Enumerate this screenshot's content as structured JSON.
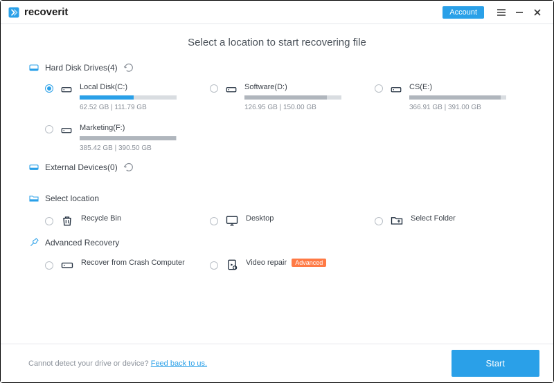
{
  "brand": {
    "name": "recoverit"
  },
  "account_label": "Account",
  "page_title": "Select a location to start recovering file",
  "sections": {
    "hdd": {
      "label": "Hard Disk Drives(4)"
    },
    "ext": {
      "label": "External Devices(0)"
    },
    "select_loc": {
      "label": "Select location"
    },
    "advanced": {
      "label": "Advanced Recovery"
    }
  },
  "drives": [
    {
      "name": "Local Disk(C:)",
      "used": 62.52,
      "total": 111.79,
      "size_text": "62.52  GB | 111.79  GB",
      "selected": true
    },
    {
      "name": "Software(D:)",
      "used": 126.95,
      "total": 150.0,
      "size_text": "126.95  GB | 150.00  GB",
      "selected": false
    },
    {
      "name": "CS(E:)",
      "used": 366.91,
      "total": 391.0,
      "size_text": "366.91  GB | 391.00  GB",
      "selected": false
    },
    {
      "name": "Marketing(F:)",
      "used": 385.42,
      "total": 390.5,
      "size_text": "385.42  GB | 390.50  GB",
      "selected": false
    }
  ],
  "locations": [
    {
      "name": "Recycle Bin"
    },
    {
      "name": "Desktop"
    },
    {
      "name": "Select Folder"
    }
  ],
  "advanced_items": [
    {
      "name": "Recover from Crash Computer",
      "badge": null
    },
    {
      "name": "Video repair",
      "badge": "Advanced"
    }
  ],
  "footer": {
    "prompt": "Cannot detect your drive or device? ",
    "link": "Feed back to us.",
    "start": "Start"
  }
}
